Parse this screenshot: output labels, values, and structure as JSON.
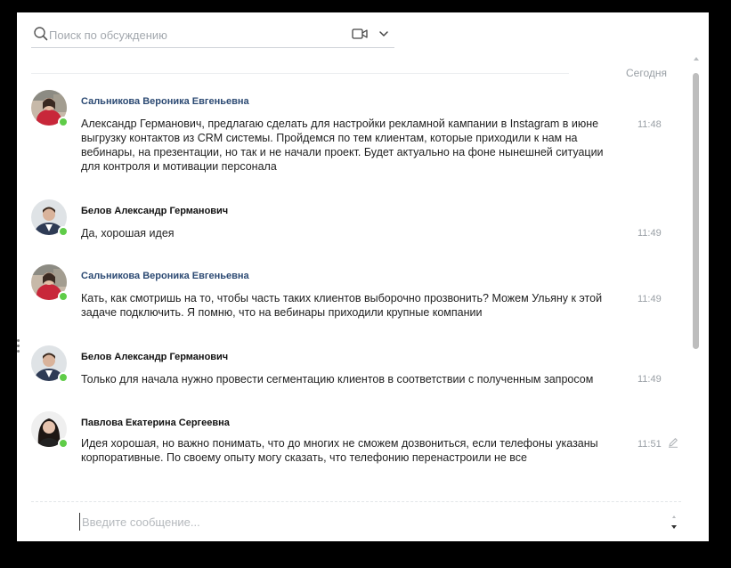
{
  "search": {
    "placeholder": "Поиск по обсуждению",
    "value": ""
  },
  "icons": {
    "search": "search-icon",
    "video": "video-camera-icon",
    "chevron": "chevron-down-icon",
    "edit": "pencil-icon"
  },
  "date_divider": "Сегодня",
  "colors": {
    "online": "#5fcc48",
    "author_link": "#2c4a73"
  },
  "messages": [
    {
      "author": "Сальникова Вероника Евгеньевна",
      "lines": [
        "Александр Германович, предлагаю сделать для настройки рекламной кампании в Instagram в июне",
        "выгрузку контактов из CRM системы. Пройдемся по тем клиентам, которые приходили к нам на",
        "вебинары, на презентации, но так и не начали проект. Будет актуально на фоне нынешней ситуации",
        "для контроля и мотивации персонала"
      ],
      "time": "11:48"
    },
    {
      "author": "Белов Александр Германович",
      "lines": [
        "Да, хорошая идея"
      ],
      "time": "11:49"
    },
    {
      "author": "Сальникова Вероника Евгеньевна",
      "lines": [
        "Кать, как смотришь на то, чтобы часть таких клиентов выборочно прозвонить? Можем Ульяну к этой",
        "задаче подключить. Я помню, что на вебинары приходили крупные компании"
      ],
      "time": "11:49"
    },
    {
      "author": "Белов Александр Германович",
      "lines": [
        "Только для начала нужно провести сегментацию клиентов в соответствии с полученным запросом"
      ],
      "time": "11:49"
    },
    {
      "author": "Павлова Екатерина Сергеевна",
      "lines": [
        "Идея хорошая, но важно понимать, что до многих не сможем дозвониться, если телефоны указаны",
        "корпоративные. По своему опыту могу сказать, что телефонию перенастроили не все"
      ],
      "time": "11:51"
    }
  ],
  "composer": {
    "placeholder": "Введите сообщение...",
    "value": ""
  }
}
